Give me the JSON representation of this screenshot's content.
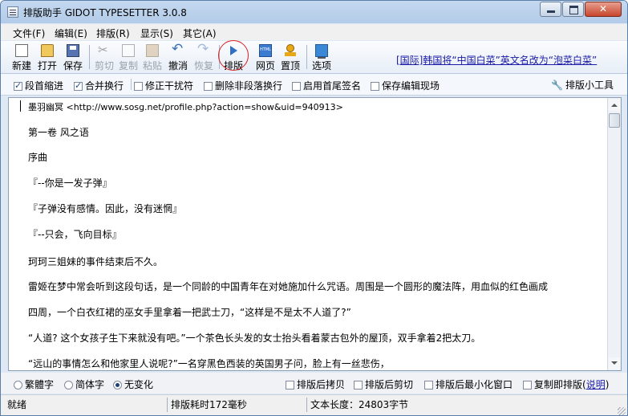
{
  "window": {
    "title": "排版助手 GIDOT TYPESETTER 3.0.8"
  },
  "menu": [
    "文件(F)",
    "编辑(E)",
    "排版(R)",
    "显示(S)",
    "其它(A)"
  ],
  "toolbar": {
    "new": "新建",
    "open": "打开",
    "save": "保存",
    "cut": "剪切",
    "copy": "复制",
    "paste": "粘贴",
    "undo": "撤消",
    "redo": "恢复",
    "typeset": "排版",
    "webpage": "网页",
    "pin_top": "置顶",
    "options": "选项",
    "news_link": "[国际]韩国将“中国白菜”英文名改为“泡菜白菜”"
  },
  "options": {
    "para_indent": {
      "label": "段首缩进",
      "checked": true
    },
    "merge_lines": {
      "label": "合并换行",
      "checked": true
    },
    "fix_interference": {
      "label": "修正干扰符",
      "checked": false
    },
    "remove_non_para": {
      "label": "删除非段落换行",
      "checked": false
    },
    "head_tail_sign": {
      "label": "启用首尾签名",
      "checked": false
    },
    "save_scene": {
      "label": "保存编辑现场",
      "checked": false
    },
    "tools": "排版小工具"
  },
  "editor": {
    "lines": [
      "墨羽幽冥 <http://www.sosg.net/profile.php?action=show&uid=940913>",
      "第一卷 风之语",
      "序曲",
      "『--你是一发子弹』",
      "『子弹没有感情。因此，没有迷惘』",
      "『--只会，飞向目标』",
      "珂珂三姐妹的事件结束后不久。",
      "雷姬在梦中常会听到这段句话，是一个同龄的中国青年在对她施加什么咒语。周围是一个圆形的魔法阵，用血似的红色画成",
      "四周，一个白衣红裙的巫女手里拿着一把武士刀，“这样是不是太不人道了?”",
      "“人道? 这个女孩子生下来就没有吧。”一个茶色长头发的女士抬头看着蒙古包外的屋顶，双手拿着2把太刀。",
      "“远山的事情怎么和他家里人说呢?”一名穿黑色西装的英国男子问，脸上有一丝悲伤，"
    ]
  },
  "bottom": {
    "traditional": "繁體字",
    "simplified": "简体字",
    "no_change": "无变化",
    "selected": "no_change",
    "copy_after": {
      "label": "排版后拷贝",
      "checked": false
    },
    "cut_after": {
      "label": "排版后剪切",
      "checked": false
    },
    "minimize_after": {
      "label": "排版后最小化窗口",
      "checked": false
    },
    "copy_instant": {
      "label": "复制即排版",
      "checked": false
    },
    "help_open": "(",
    "help": "说明",
    "help_close": ")"
  },
  "status": {
    "state": "就绪",
    "elapsed": "排版耗时172毫秒",
    "length": "文本长度：24803字节"
  }
}
